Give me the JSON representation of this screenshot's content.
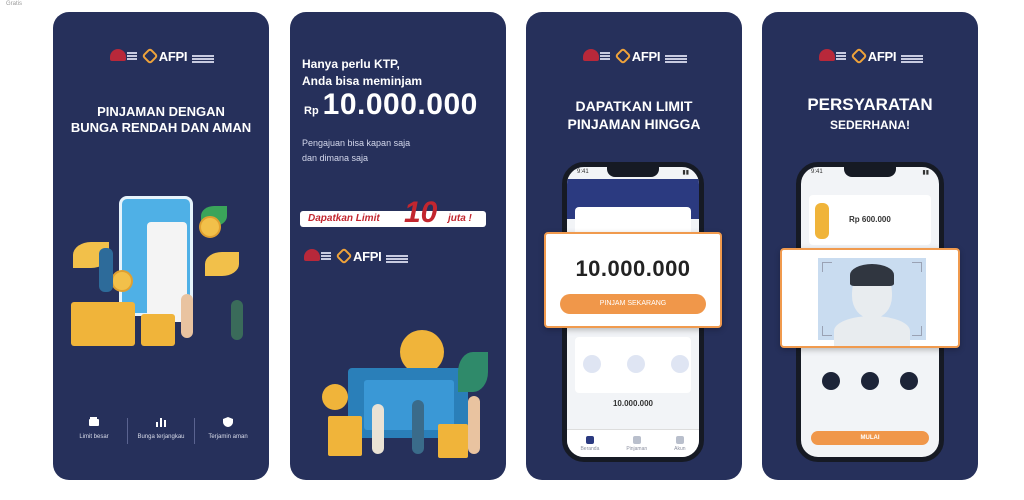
{
  "caption": "Gratis",
  "panel1": {
    "headline": "PINJAMAN DENGAN\nBUNGA RENDAH  DAN AMAN",
    "features": [
      {
        "label": "Limit besar",
        "icon": "wallet-icon"
      },
      {
        "label": "Bunga terjangkau",
        "icon": "bar-chart-icon"
      },
      {
        "label": "Terjamin aman",
        "icon": "shield-check-icon"
      }
    ]
  },
  "panel2": {
    "intro": "Hanya perlu KTP,\nAnda bisa meminjam",
    "currency": "Rp",
    "amount": "10.000.000",
    "description": "Pengajuan bisa kapan saja\ndan dimana saja",
    "promo_prefix": "Dapatkan Limit",
    "promo_number": "10",
    "promo_suffix": "juta !"
  },
  "panel3": {
    "headline": "DAPATKAN LIMIT\nPINJAMAN HINGGA",
    "limit": "10.000.000",
    "limit_button": "PINJAM SEKARANG",
    "phone_time": "9:41",
    "bottom_amount": "10.000.000",
    "tabs": [
      "Beranda",
      "Pinjaman",
      "Akun"
    ]
  },
  "panel4": {
    "headline": "PERSYARATAN",
    "sub": "SEDERHANA!",
    "phone_time": "9:41",
    "amount": "Rp 600.000",
    "button": "MULAI"
  },
  "colors": {
    "panel_bg": "#26305b",
    "accent_orange": "#f0974a",
    "promo_red": "#c2262f",
    "coin_gold": "#f0b43a"
  }
}
